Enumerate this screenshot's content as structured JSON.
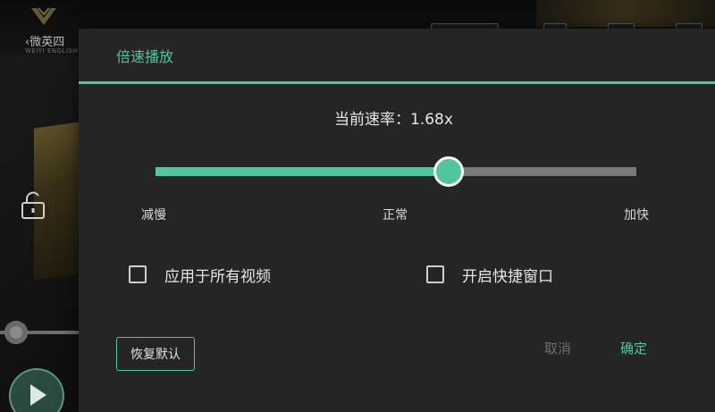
{
  "background": {
    "app_logo_text": "微英",
    "back_label": "微英",
    "back_label_suffix": "四",
    "logo_subtext": "WEIYI ENGLISH"
  },
  "dialog": {
    "title": "倍速播放",
    "rate_prefix": "当前速率：",
    "rate_value": "1.68x",
    "slider": {
      "value_fraction": 0.61,
      "label_min": "减慢",
      "label_mid": "正常",
      "label_max": "加快"
    },
    "apply_all": {
      "label": "应用于所有视频",
      "checked": false
    },
    "shortcut_window": {
      "label": "开启快捷窗口",
      "checked": false
    },
    "reset_label": "恢复默认",
    "cancel_label": "取消",
    "ok_label": "确定"
  },
  "colors": {
    "accent": "#4fc79a",
    "dialog_bg": "#252525",
    "text_primary": "#e6e6e6",
    "text_disabled": "#6e6e6e"
  }
}
